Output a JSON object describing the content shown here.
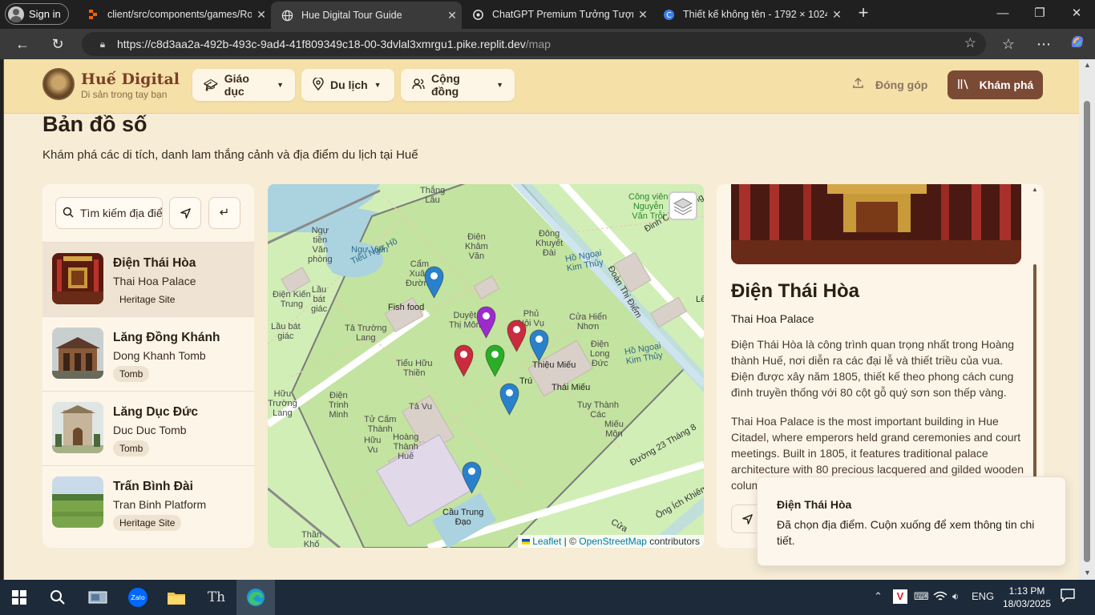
{
  "browser": {
    "signin_label": "Sign in",
    "tabs": [
      {
        "title": "client/src/components/games/Ro",
        "icon": "replit-icon"
      },
      {
        "title": "Hue Digital Tour Guide",
        "icon": "globe-icon"
      },
      {
        "title": "ChatGPT Premium Tưởng Tượng",
        "icon": "chatgpt-icon"
      },
      {
        "title": "Thiết kế không tên - 1792 × 1024",
        "icon": "canva-icon"
      }
    ],
    "url_host": "https://c8d3aa2a-492b-493c-9ad4-41f809349c18-00-3dvlal3xmrgu1.pike.replit.dev",
    "url_path": "/map"
  },
  "header": {
    "brand": "Huế Digital",
    "tagline": "Di sản trong tay bạn",
    "menus": [
      "Giáo dục",
      "Du lịch",
      "Cộng đồng"
    ],
    "contribute": "Đóng góp",
    "explore": "Khám phá"
  },
  "page": {
    "title": "Bản đồ số",
    "subtitle": "Khám phá các di tích, danh lam thắng cảnh và địa điểm du lịch tại Huế"
  },
  "search": {
    "placeholder": "Tìm kiếm địa điểm..."
  },
  "places": [
    {
      "name": "Điện Thái Hòa",
      "en": "Thai Hoa Palace",
      "tag": "Heritage Site"
    },
    {
      "name": "Lăng Đồng Khánh",
      "en": "Dong Khanh Tomb",
      "tag": "Tomb"
    },
    {
      "name": "Lăng Dục Đức",
      "en": "Duc Duc Tomb",
      "tag": "Tomb"
    },
    {
      "name": "Trấn Bình Đài",
      "en": "Tran Binh Platform",
      "tag": "Heritage Site"
    }
  ],
  "map": {
    "labels": {
      "l_thang_lau": "Thắng\nLâu",
      "l_cong_vien": "Công viên\nNguyễn\nVăn Trỗi",
      "l_ngu_tien": "Ngự\ntiền\nVăn\nphòng",
      "l_ngu_vien": "Ngự Viên",
      "l_tieu_ngu_ho": "Tiểu Ngự Hồ",
      "l_dien_kham_van": "Điện\nKhâm\nVăn",
      "l_dong_khuyet": "Đông\nKhuyết\nĐài",
      "l_ho_ngoai_kim_thuy": "Hồ Ngoại\nKim Thủy",
      "l_dinh_cong_trang": "Đinh Công Tráng",
      "l_cam_xuan": "Cẩm\nXuân\nĐường",
      "l_dien_kien_trung": "Điện Kiến\nTrung",
      "l_lau_bat_giac1": "Lầu\nbát\ngiác",
      "l_lau_bat_giac2": "Lầu bát\ngiác",
      "l_fish_food": "Fish food",
      "l_duyet_thi": "Duyệt\nThị Môn",
      "l_ta_truong_lang": "Tả Trường\nLang",
      "l_phu_noi_vu": "Phủ\nNội Vụ",
      "l_cua_hien_nhon": "Cửa Hiển\nNhơn",
      "l_doan_thi_diem": "Đoàn Thị Điểm",
      "l_tieu_huu": "Tiểu Hữu\nThiền",
      "l_thieu_mieu": "Thiệu Miếu",
      "l_dien_long_duc": "Điện\nLong\nĐức",
      "l_ho_ngoai_kim_thuy2": "Hồ Ngoại\nKim Thủy",
      "l_huu_truong_lang": "Hữu\nTrường\nLang",
      "l_dien_trinh_minh": "Điện\nTrinh\nMinh",
      "l_ta_vu": "Tả Vu",
      "l_thai_mieu": "Thái Miếu",
      "l_tuy_thanh": "Tuy Thành\nCác",
      "l_mieu_mon": "Miếu\nMôn",
      "l_tu_cam_thanh": "Tử Cấm\nThành",
      "l_huu_vu": "Hữu\nVu",
      "l_hoang_thanh_hue": "Hoàng\nThành\nHuế",
      "l_duong_23_thang_8": "Đường 23 Tháng 8",
      "l_ong_ich_khiem": "Ông Ích Khiêm",
      "l_cau_trung_dao": "Cầu Trung\nĐạo",
      "l_cua": "Cửa",
      "l_than_kho": "Thần\nKhố",
      "l_le": "Lê",
      "l_tu": "Trú"
    },
    "attribution_leaflet": "Leaflet",
    "attribution_sep": " | © ",
    "attribution_osm": "OpenStreetMap",
    "attribution_tail": " contributors",
    "marker_colors": {
      "blue": "#2a81cb",
      "red": "#cb2b3e",
      "green": "#2aad27",
      "violet": "#9c2bcb"
    }
  },
  "detail": {
    "title": "Điện Thái Hòa",
    "subtitle": "Thai Hoa Palace",
    "desc_vi": "Điện Thái Hòa là công trình quan trọng nhất trong Hoàng thành Huế, nơi diễn ra các đại lễ và thiết triều của vua. Điện được xây năm 1805, thiết kế theo phong cách cung đình truyền thống với 80 cột gỗ quý sơn son thếp vàng.",
    "desc_en": "Thai Hoa Palace is the most important building in Hue Citadel, where emperors held grand ceremonies and court meetings. Built in 1805, it features traditional palace architecture with 80 precious lacquered and gilded wooden columns."
  },
  "toast": {
    "title": "Điện Thái Hòa",
    "body": "Đã chọn địa điểm. Cuộn xuống để xem thông tin chi tiết."
  },
  "taskbar": {
    "time": "1:13 PM",
    "date": "18/03/2025",
    "lang": "ENG"
  },
  "colors": {
    "header_bg": "#f5e0a8",
    "page_bg": "#f7ecd6",
    "brand": "#7b3f27",
    "explore_btn": "#7a4a35"
  }
}
